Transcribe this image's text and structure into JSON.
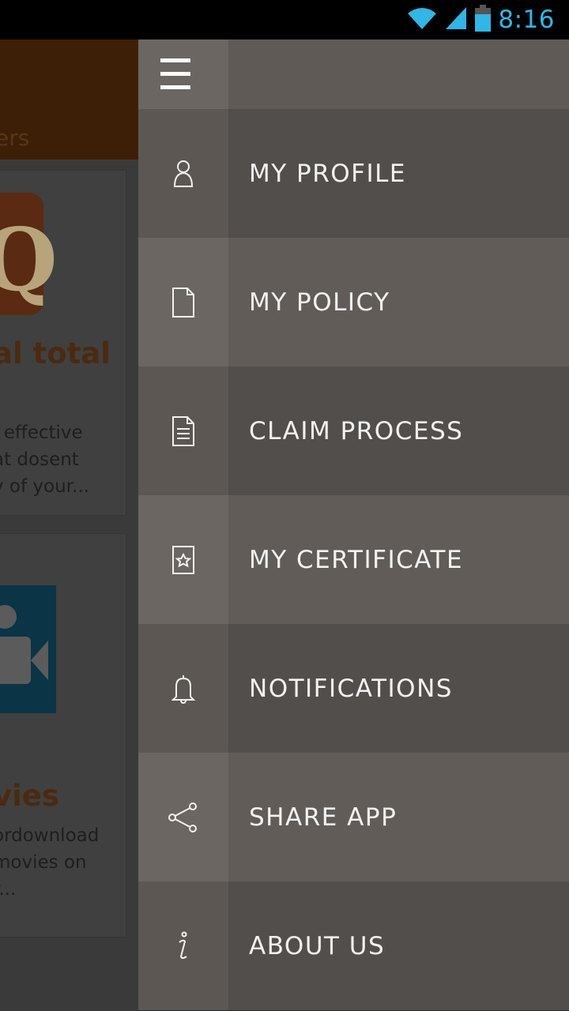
{
  "status_bar": {
    "time": "8:16",
    "icons": [
      "wifi-icon",
      "signal-icon",
      "battery-icon"
    ],
    "accent_color": "#33b5e5"
  },
  "background_app": {
    "banner_fragment": "ers",
    "card1": {
      "logo_letter": "Q",
      "title_fragment": "al total",
      "description": "l effective\nat dosent\ny of your..."
    },
    "card2": {
      "title_fragment": "vies",
      "description": "ordownload\nmovies on\nr..."
    }
  },
  "drawer": {
    "menu_icon": "hamburger-icon",
    "items": [
      {
        "label": "MY PROFILE",
        "icon": "person-icon"
      },
      {
        "label": "MY POLICY",
        "icon": "document-icon"
      },
      {
        "label": "CLAIM PROCESS",
        "icon": "text-document-icon"
      },
      {
        "label": "MY CERTIFICATE",
        "icon": "certificate-star-icon"
      },
      {
        "label": "NOTIFICATIONS",
        "icon": "bell-icon"
      },
      {
        "label": "SHARE APP",
        "icon": "share-icon"
      },
      {
        "label": "ABOUT US",
        "icon": "info-icon"
      }
    ]
  }
}
